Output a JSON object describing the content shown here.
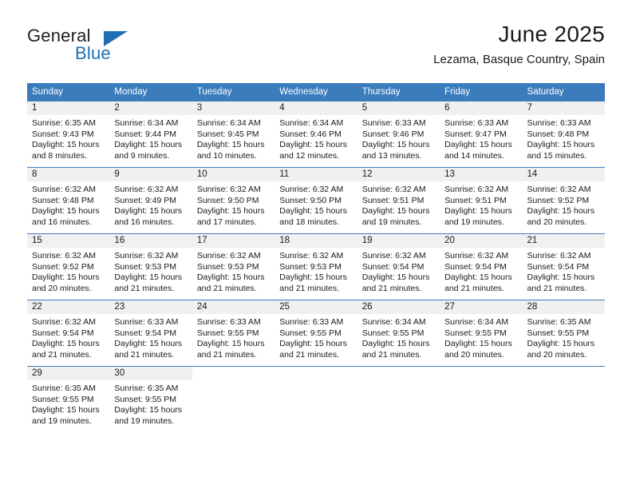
{
  "logo": {
    "primary_text": "General",
    "secondary_text": "Blue",
    "triangle_color": "#1f6eb4",
    "primary_color": "#231f20",
    "secondary_color": "#1f6eb4"
  },
  "header": {
    "month_title": "June 2025",
    "location": "Lezama, Basque Country, Spain"
  },
  "theme": {
    "header_bg": "#3b7cbd",
    "header_text": "#ffffff",
    "daynum_bg": "#f0f0f0",
    "row_border": "#3b7cbd",
    "body_text": "#1a1a1a"
  },
  "calendar": {
    "weekday_headers": [
      "Sunday",
      "Monday",
      "Tuesday",
      "Wednesday",
      "Thursday",
      "Friday",
      "Saturday"
    ],
    "weeks": [
      [
        {
          "day": "1",
          "sunrise": "Sunrise: 6:35 AM",
          "sunset": "Sunset: 9:43 PM",
          "daylight_line1": "Daylight: 15 hours",
          "daylight_line2": "and 8 minutes."
        },
        {
          "day": "2",
          "sunrise": "Sunrise: 6:34 AM",
          "sunset": "Sunset: 9:44 PM",
          "daylight_line1": "Daylight: 15 hours",
          "daylight_line2": "and 9 minutes."
        },
        {
          "day": "3",
          "sunrise": "Sunrise: 6:34 AM",
          "sunset": "Sunset: 9:45 PM",
          "daylight_line1": "Daylight: 15 hours",
          "daylight_line2": "and 10 minutes."
        },
        {
          "day": "4",
          "sunrise": "Sunrise: 6:34 AM",
          "sunset": "Sunset: 9:46 PM",
          "daylight_line1": "Daylight: 15 hours",
          "daylight_line2": "and 12 minutes."
        },
        {
          "day": "5",
          "sunrise": "Sunrise: 6:33 AM",
          "sunset": "Sunset: 9:46 PM",
          "daylight_line1": "Daylight: 15 hours",
          "daylight_line2": "and 13 minutes."
        },
        {
          "day": "6",
          "sunrise": "Sunrise: 6:33 AM",
          "sunset": "Sunset: 9:47 PM",
          "daylight_line1": "Daylight: 15 hours",
          "daylight_line2": "and 14 minutes."
        },
        {
          "day": "7",
          "sunrise": "Sunrise: 6:33 AM",
          "sunset": "Sunset: 9:48 PM",
          "daylight_line1": "Daylight: 15 hours",
          "daylight_line2": "and 15 minutes."
        }
      ],
      [
        {
          "day": "8",
          "sunrise": "Sunrise: 6:32 AM",
          "sunset": "Sunset: 9:48 PM",
          "daylight_line1": "Daylight: 15 hours",
          "daylight_line2": "and 16 minutes."
        },
        {
          "day": "9",
          "sunrise": "Sunrise: 6:32 AM",
          "sunset": "Sunset: 9:49 PM",
          "daylight_line1": "Daylight: 15 hours",
          "daylight_line2": "and 16 minutes."
        },
        {
          "day": "10",
          "sunrise": "Sunrise: 6:32 AM",
          "sunset": "Sunset: 9:50 PM",
          "daylight_line1": "Daylight: 15 hours",
          "daylight_line2": "and 17 minutes."
        },
        {
          "day": "11",
          "sunrise": "Sunrise: 6:32 AM",
          "sunset": "Sunset: 9:50 PM",
          "daylight_line1": "Daylight: 15 hours",
          "daylight_line2": "and 18 minutes."
        },
        {
          "day": "12",
          "sunrise": "Sunrise: 6:32 AM",
          "sunset": "Sunset: 9:51 PM",
          "daylight_line1": "Daylight: 15 hours",
          "daylight_line2": "and 19 minutes."
        },
        {
          "day": "13",
          "sunrise": "Sunrise: 6:32 AM",
          "sunset": "Sunset: 9:51 PM",
          "daylight_line1": "Daylight: 15 hours",
          "daylight_line2": "and 19 minutes."
        },
        {
          "day": "14",
          "sunrise": "Sunrise: 6:32 AM",
          "sunset": "Sunset: 9:52 PM",
          "daylight_line1": "Daylight: 15 hours",
          "daylight_line2": "and 20 minutes."
        }
      ],
      [
        {
          "day": "15",
          "sunrise": "Sunrise: 6:32 AM",
          "sunset": "Sunset: 9:52 PM",
          "daylight_line1": "Daylight: 15 hours",
          "daylight_line2": "and 20 minutes."
        },
        {
          "day": "16",
          "sunrise": "Sunrise: 6:32 AM",
          "sunset": "Sunset: 9:53 PM",
          "daylight_line1": "Daylight: 15 hours",
          "daylight_line2": "and 21 minutes."
        },
        {
          "day": "17",
          "sunrise": "Sunrise: 6:32 AM",
          "sunset": "Sunset: 9:53 PM",
          "daylight_line1": "Daylight: 15 hours",
          "daylight_line2": "and 21 minutes."
        },
        {
          "day": "18",
          "sunrise": "Sunrise: 6:32 AM",
          "sunset": "Sunset: 9:53 PM",
          "daylight_line1": "Daylight: 15 hours",
          "daylight_line2": "and 21 minutes."
        },
        {
          "day": "19",
          "sunrise": "Sunrise: 6:32 AM",
          "sunset": "Sunset: 9:54 PM",
          "daylight_line1": "Daylight: 15 hours",
          "daylight_line2": "and 21 minutes."
        },
        {
          "day": "20",
          "sunrise": "Sunrise: 6:32 AM",
          "sunset": "Sunset: 9:54 PM",
          "daylight_line1": "Daylight: 15 hours",
          "daylight_line2": "and 21 minutes."
        },
        {
          "day": "21",
          "sunrise": "Sunrise: 6:32 AM",
          "sunset": "Sunset: 9:54 PM",
          "daylight_line1": "Daylight: 15 hours",
          "daylight_line2": "and 21 minutes."
        }
      ],
      [
        {
          "day": "22",
          "sunrise": "Sunrise: 6:32 AM",
          "sunset": "Sunset: 9:54 PM",
          "daylight_line1": "Daylight: 15 hours",
          "daylight_line2": "and 21 minutes."
        },
        {
          "day": "23",
          "sunrise": "Sunrise: 6:33 AM",
          "sunset": "Sunset: 9:54 PM",
          "daylight_line1": "Daylight: 15 hours",
          "daylight_line2": "and 21 minutes."
        },
        {
          "day": "24",
          "sunrise": "Sunrise: 6:33 AM",
          "sunset": "Sunset: 9:55 PM",
          "daylight_line1": "Daylight: 15 hours",
          "daylight_line2": "and 21 minutes."
        },
        {
          "day": "25",
          "sunrise": "Sunrise: 6:33 AM",
          "sunset": "Sunset: 9:55 PM",
          "daylight_line1": "Daylight: 15 hours",
          "daylight_line2": "and 21 minutes."
        },
        {
          "day": "26",
          "sunrise": "Sunrise: 6:34 AM",
          "sunset": "Sunset: 9:55 PM",
          "daylight_line1": "Daylight: 15 hours",
          "daylight_line2": "and 21 minutes."
        },
        {
          "day": "27",
          "sunrise": "Sunrise: 6:34 AM",
          "sunset": "Sunset: 9:55 PM",
          "daylight_line1": "Daylight: 15 hours",
          "daylight_line2": "and 20 minutes."
        },
        {
          "day": "28",
          "sunrise": "Sunrise: 6:35 AM",
          "sunset": "Sunset: 9:55 PM",
          "daylight_line1": "Daylight: 15 hours",
          "daylight_line2": "and 20 minutes."
        }
      ],
      [
        {
          "day": "29",
          "sunrise": "Sunrise: 6:35 AM",
          "sunset": "Sunset: 9:55 PM",
          "daylight_line1": "Daylight: 15 hours",
          "daylight_line2": "and 19 minutes."
        },
        {
          "day": "30",
          "sunrise": "Sunrise: 6:35 AM",
          "sunset": "Sunset: 9:55 PM",
          "daylight_line1": "Daylight: 15 hours",
          "daylight_line2": "and 19 minutes."
        },
        {
          "day": "",
          "sunrise": "",
          "sunset": "",
          "daylight_line1": "",
          "daylight_line2": ""
        },
        {
          "day": "",
          "sunrise": "",
          "sunset": "",
          "daylight_line1": "",
          "daylight_line2": ""
        },
        {
          "day": "",
          "sunrise": "",
          "sunset": "",
          "daylight_line1": "",
          "daylight_line2": ""
        },
        {
          "day": "",
          "sunrise": "",
          "sunset": "",
          "daylight_line1": "",
          "daylight_line2": ""
        },
        {
          "day": "",
          "sunrise": "",
          "sunset": "",
          "daylight_line1": "",
          "daylight_line2": ""
        }
      ]
    ]
  }
}
